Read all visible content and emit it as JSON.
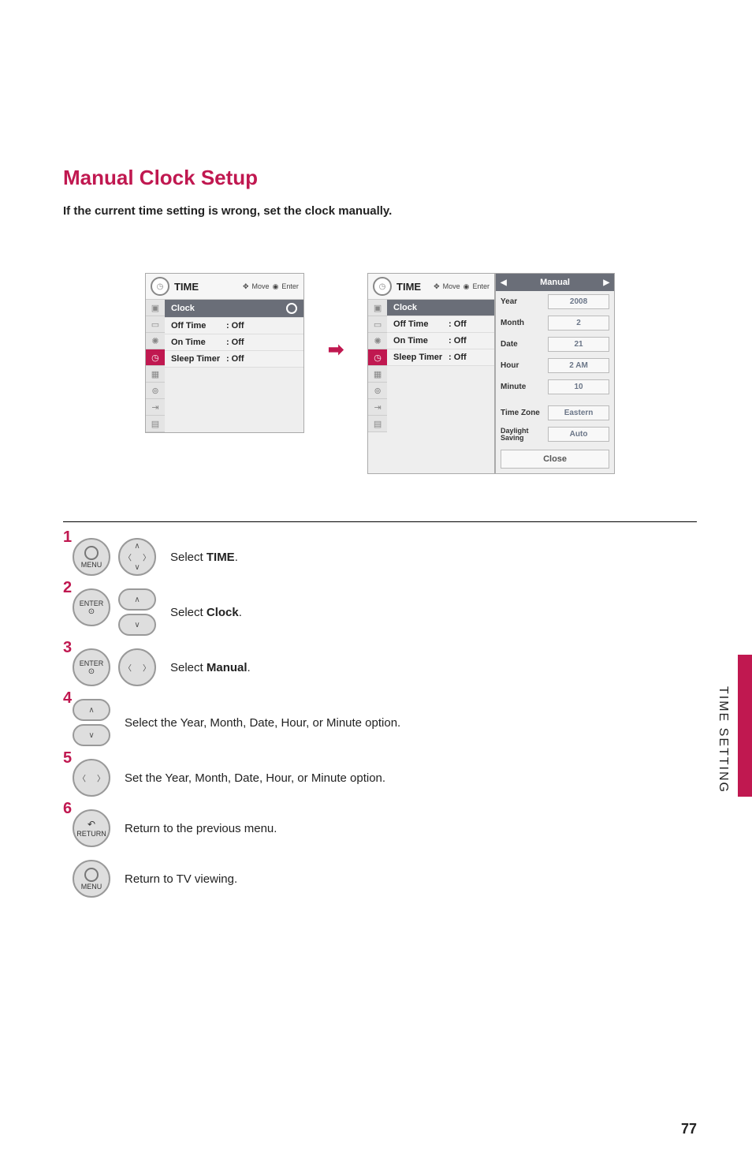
{
  "title": "Manual Clock Setup",
  "description": "If the current time setting is wrong, set the clock manually.",
  "side_label": "TIME SETTING",
  "page_num": "77",
  "osd": {
    "title": "TIME",
    "hint_move": "Move",
    "hint_enter": "Enter",
    "rows": {
      "clock": {
        "label": "Clock",
        "value": ""
      },
      "offtime": {
        "label": "Off Time",
        "value": ": Off"
      },
      "ontime": {
        "label": "On Time",
        "value": ": Off"
      },
      "sleep": {
        "label": "Sleep Timer",
        "value": ": Off"
      }
    }
  },
  "detail": {
    "mode": "Manual",
    "year": {
      "label": "Year",
      "value": "2008"
    },
    "month": {
      "label": "Month",
      "value": "2"
    },
    "date": {
      "label": "Date",
      "value": "21"
    },
    "hour": {
      "label": "Hour",
      "value": "2 AM"
    },
    "minute": {
      "label": "Minute",
      "value": "10"
    },
    "tz": {
      "label": "Time Zone",
      "value": "Eastern"
    },
    "ds": {
      "label": "Daylight Saving",
      "value": "Auto"
    },
    "close": "Close"
  },
  "steps": {
    "s1": {
      "num": "1",
      "btn": "MENU",
      "pre": "Select ",
      "bold": "TIME",
      "post": "."
    },
    "s2": {
      "num": "2",
      "btn": "ENTER",
      "pre": "Select ",
      "bold": "Clock",
      "post": "."
    },
    "s3": {
      "num": "3",
      "btn": "ENTER",
      "pre": "Select ",
      "bold": "Manual",
      "post": "."
    },
    "s4": {
      "num": "4",
      "text": "Select the Year, Month, Date, Hour, or Minute option."
    },
    "s5": {
      "num": "5",
      "text": "Set the Year, Month, Date, Hour, or Minute option."
    },
    "s6": {
      "num": "6",
      "btn": "RETURN",
      "text": "Return to the previous menu."
    },
    "s7": {
      "btn": "MENU",
      "text": "Return to TV viewing."
    }
  }
}
